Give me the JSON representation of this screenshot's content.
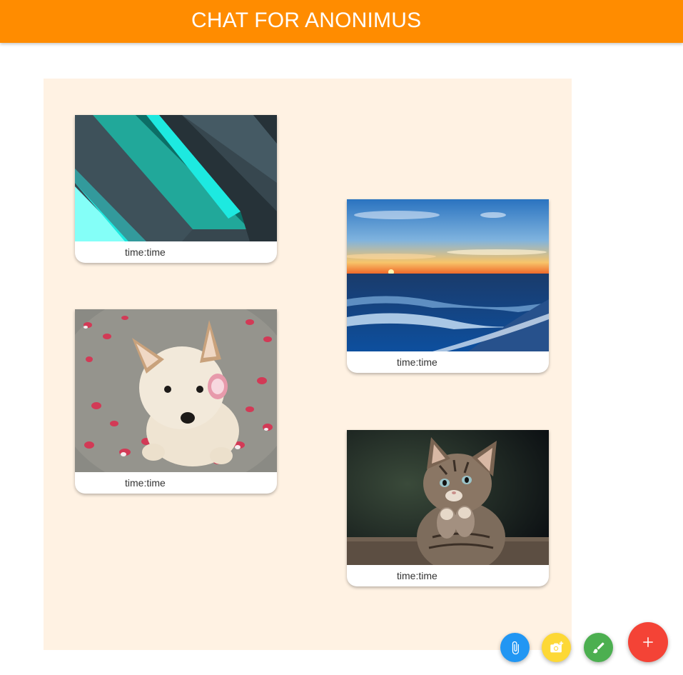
{
  "header": {
    "title": "CHAT FOR ANONIMUS"
  },
  "messages": [
    {
      "image": "abstract-teal-stripes-image",
      "time": "time:time"
    },
    {
      "image": "ocean-sunset-image",
      "time": "time:time"
    },
    {
      "image": "puppy-with-petals-image",
      "time": "time:time"
    },
    {
      "image": "kitten-image",
      "time": "time:time"
    }
  ],
  "actions": [
    {
      "icon": "paperclip-icon",
      "color": "#2196f3"
    },
    {
      "icon": "camera-icon",
      "color": "#fdd835"
    },
    {
      "icon": "brush-icon",
      "color": "#4caf50"
    },
    {
      "icon": "plus-icon",
      "color": "#f44336"
    }
  ],
  "colors": {
    "header": "#ff8c00",
    "panel": "#fff2e3"
  }
}
